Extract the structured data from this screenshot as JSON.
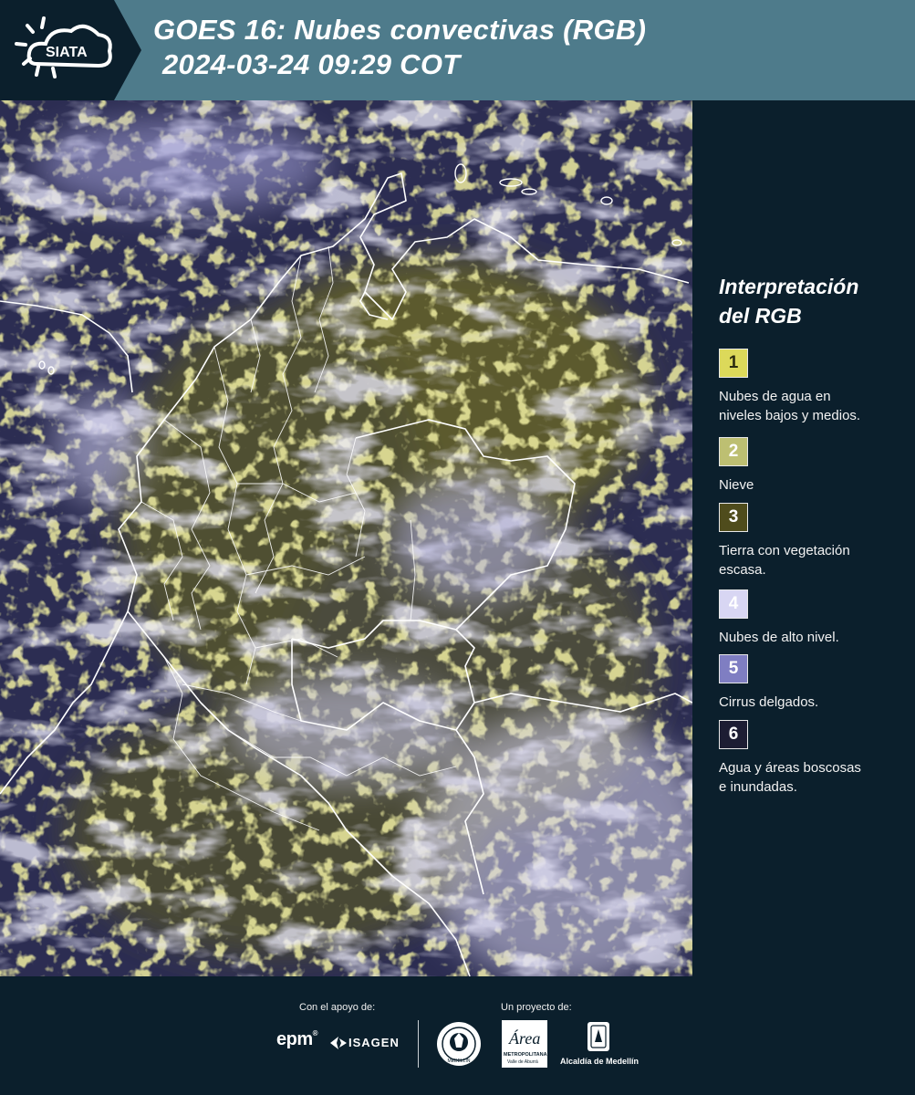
{
  "header": {
    "title_line1": "GOES 16: Nubes convectivas (RGB)",
    "title_line2": "2024-03-24 09:29 COT",
    "logo_text": "SIATA",
    "header_color": "#4e7b8b",
    "logo_bg_color": "#0b1f2c"
  },
  "legend": {
    "title_line1": "Interpretación",
    "title_line2": "del RGB",
    "items": [
      {
        "number": "1",
        "label_line1": "Nubes de agua en",
        "label_line2": "niveles bajos y medios.",
        "color": "#dcd95a",
        "text_color": "#2b2b10"
      },
      {
        "number": "2",
        "label_line1": "Nieve",
        "label_line2": "",
        "color": "#bdbf72",
        "text_color": "#ffffff"
      },
      {
        "number": "3",
        "label_line1": "Tierra con vegetación",
        "label_line2": "escasa.",
        "color": "#4f4c1c",
        "text_color": "#ffffff"
      },
      {
        "number": "4",
        "label_line1": "Nubes de alto nivel.",
        "label_line2": "",
        "color": "#d8d6f3",
        "text_color": "#ffffff"
      },
      {
        "number": "5",
        "label_line1": "Cirrus delgados.",
        "label_line2": "",
        "color": "#7f7ec2",
        "text_color": "#ffffff"
      },
      {
        "number": "6",
        "label_line1": "Agua y áreas boscosas",
        "label_line2": "e inundadas.",
        "color": "#1d1d33",
        "text_color": "#ffffff"
      }
    ]
  },
  "footer": {
    "support_label": "Con el apoyo de:",
    "project_label": "Un proyecto de:",
    "epm_text": "epm",
    "isagen_text": "ISAGEN",
    "area_text": "Área",
    "area_subtext1": "METROPOLITANA",
    "area_subtext2": "Valle de Aburrá",
    "alcaldia_text": "Alcaldía de Medellín",
    "seal_text": "MEDELLÍN"
  }
}
